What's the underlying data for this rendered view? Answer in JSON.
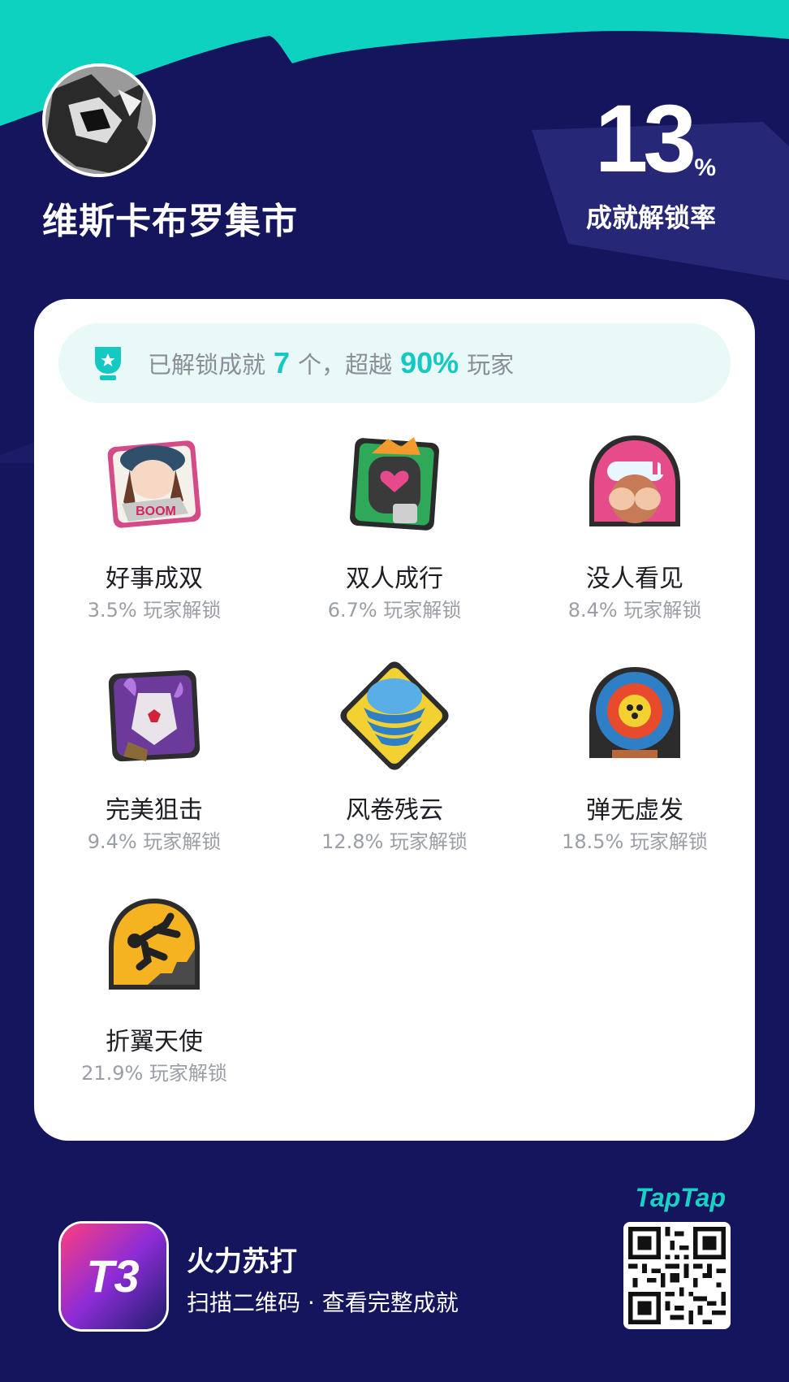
{
  "profile": {
    "user_name": "维斯卡布罗集市",
    "avatar_icon": "user-avatar"
  },
  "stats": {
    "unlock_rate_value": "13",
    "unlock_rate_unit": "%",
    "unlock_rate_label": "成就解锁率"
  },
  "summary": {
    "prefix": "已解锁成就",
    "count": "7",
    "middle": "个，超越",
    "percent": "90%",
    "suffix": "玩家",
    "icon": "trophy-icon"
  },
  "achievements": [
    {
      "name": "好事成双",
      "percent": "3.5% 玩家解锁",
      "icon": "girl-boom-badge"
    },
    {
      "name": "双人成行",
      "percent": "6.7% 玩家解锁",
      "icon": "soldier-heart-badge"
    },
    {
      "name": "没人看见",
      "percent": "8.4% 玩家解锁",
      "icon": "cover-eyes-badge"
    },
    {
      "name": "完美狙击",
      "percent": "9.4% 玩家解锁",
      "icon": "masked-sniper-badge"
    },
    {
      "name": "风卷残云",
      "percent": "12.8% 玩家解锁",
      "icon": "tornado-badge"
    },
    {
      "name": "弹无虚发",
      "percent": "18.5% 玩家解锁",
      "icon": "target-badge"
    },
    {
      "name": "折翼天使",
      "percent": "21.9% 玩家解锁",
      "icon": "falling-person-badge"
    }
  ],
  "footer": {
    "game_title": "火力苏打",
    "game_subtitle": "扫描二维码 · 查看完整成就",
    "brand": "TapTap",
    "logo_text": "T3",
    "qr_icon": "qr-code"
  },
  "colors": {
    "background": "#14155d",
    "accent": "#14c9c1",
    "card": "#ffffff"
  }
}
